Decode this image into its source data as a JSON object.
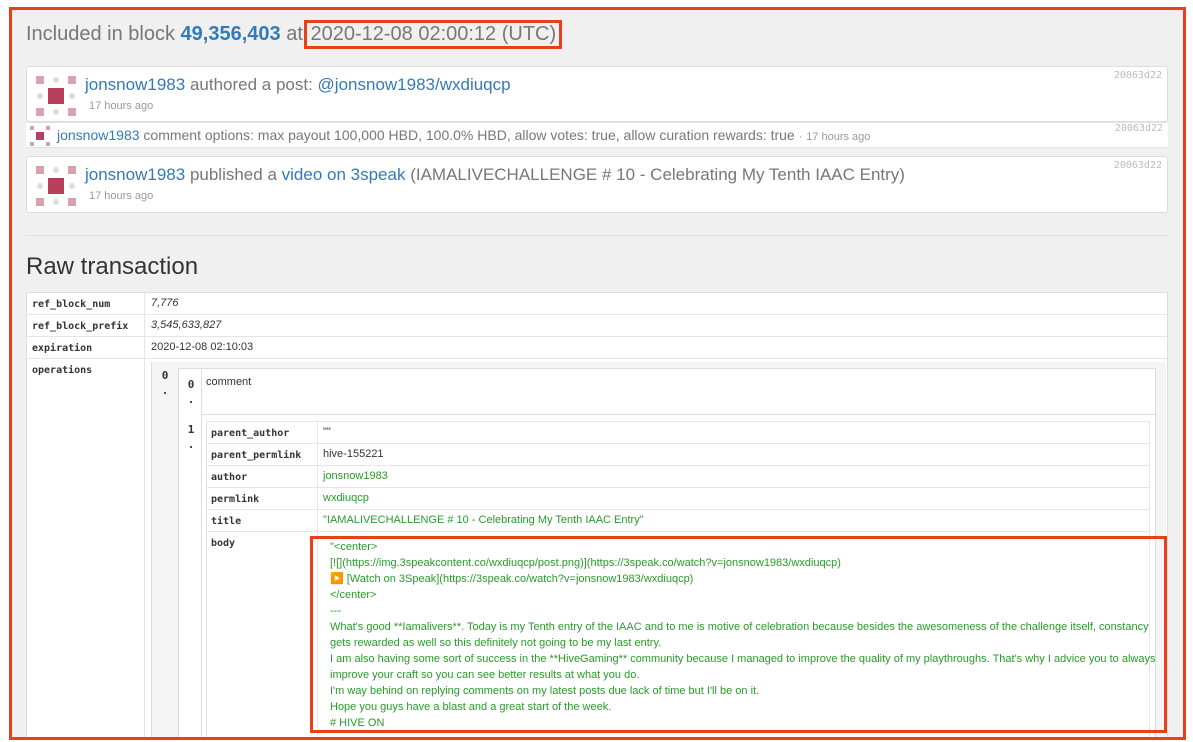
{
  "header": {
    "prefix": "Included in block",
    "block_number": "49,356,403",
    "at": "at",
    "timestamp": "2020-12-08 02:00:12 (UTC)"
  },
  "feed": [
    {
      "author": "jonsnow1983",
      "action": "authored a post:",
      "link": "@jonsnow1983/wxdiuqcp",
      "time": "17 hours ago",
      "hash": "20063d22"
    },
    {
      "author": "jonsnow1983",
      "text": "comment options: max payout 100,000 HBD, 100.0% HBD, allow votes: true, allow curation rewards: true",
      "dot": "·",
      "time": "17 hours ago",
      "hash": "20063d22"
    },
    {
      "author": "jonsnow1983",
      "action": "published a",
      "link": "video on 3speak",
      "rest": "(IAMALIVECHALLENGE # 10 - Celebrating My Tenth IAAC Entry)",
      "time": "17 hours ago",
      "hash": "20063d22"
    }
  ],
  "section_title": "Raw transaction",
  "raw": {
    "ref_block_num_key": "ref_block_num",
    "ref_block_num": "7,776",
    "ref_block_prefix_key": "ref_block_prefix",
    "ref_block_prefix": "3,545,633,827",
    "expiration_key": "expiration",
    "expiration": "2020-12-08 02:10:03",
    "operations_key": "operations",
    "op_index": "0",
    "op_type_index": "0",
    "op_type": "comment",
    "op_payload_index": "1",
    "fields": {
      "parent_author_key": "parent_author",
      "parent_author": "\"\"",
      "parent_permlink_key": "parent_permlink",
      "parent_permlink": "hive-155221",
      "author_key": "author",
      "author": "jonsnow1983",
      "permlink_key": "permlink",
      "permlink": "wxdiuqcp",
      "title_key": "title",
      "title": "\"IAMALIVECHALLENGE # 10 - Celebrating My Tenth IAAC Entry\"",
      "body_key": "body",
      "body_lines": [
        "\"<center>",
        "[![](https://img.3speakcontent.co/wxdiuqcp/post.png)](https://3speak.co/watch?v=jonsnow1983/wxdiuqcp)",
        "▶️ [Watch on 3Speak](https://3speak.co/watch?v=jonsnow1983/wxdiuqcp)",
        "</center>",
        "---",
        "What's good **Iamalivers**. Today is my Tenth entry of the IAAC and to me is motive of celebration because besides the awesomeness of the challenge itself, constancy gets rewarded as well so this definitely not going to be my last entry.",
        "I am also having some sort of success in the **HiveGaming** community because I managed to improve the quality of my playthroughs. That's why I advice you to always improve your craft so you can see better results at what you do.",
        "I'm way behind on replying comments on my latest posts due lack of time but I'll be on it.",
        "Hope you guys have a blast and a great start of the week.",
        "# HIVE ON",
        "---"
      ]
    }
  },
  "colors": {
    "highlight": "#e8411a",
    "link": "#337ab7",
    "string": "#2a9a2a",
    "avatar": "#c0506a"
  }
}
